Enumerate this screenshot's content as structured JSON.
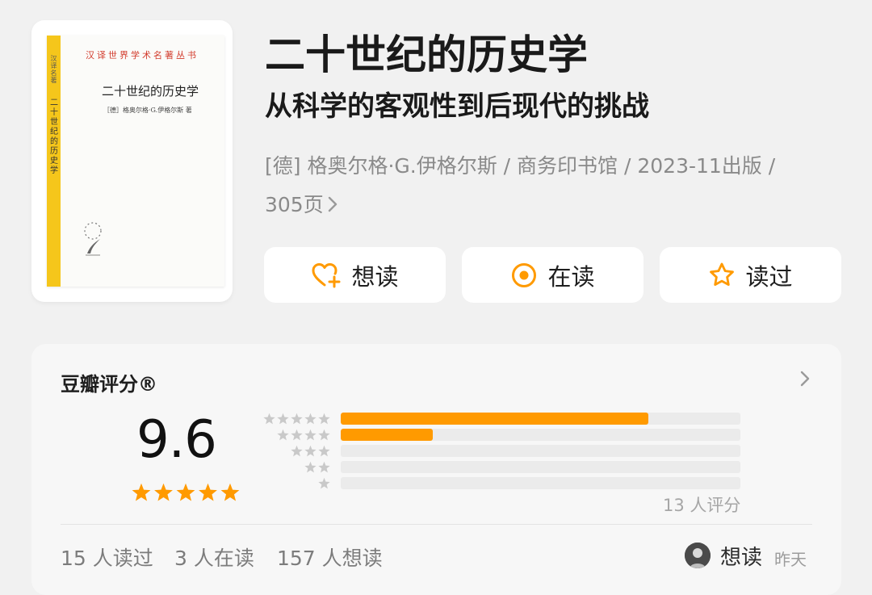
{
  "book": {
    "title": "二十世纪的历史学",
    "subtitle": "从科学的客观性到后现代的挑战",
    "meta_line": "[德] 格奥尔格·G.伊格尔斯 / 商务印书馆 / 2023-11出版 /",
    "pages": "305页",
    "cover": {
      "series": "汉译世界学术名著丛书",
      "title": "二十世纪的历史学",
      "author": "［德］格奥尔格·G.伊格尔斯 著",
      "spine_series": "汉译名著",
      "spine_title": "二十世纪的历史学",
      "publisher": "商务印书馆"
    }
  },
  "actions": {
    "want_label": "想读",
    "reading_label": "在读",
    "read_label": "读过",
    "accent": "#ff9a00"
  },
  "rating": {
    "header": "豆瓣评分®",
    "score": "9.6",
    "score_stars": 5,
    "distribution": [
      {
        "stars": 5,
        "fraction": 0.77
      },
      {
        "stars": 4,
        "fraction": 0.23
      },
      {
        "stars": 3,
        "fraction": 0
      },
      {
        "stars": 2,
        "fraction": 0
      },
      {
        "stars": 1,
        "fraction": 0
      }
    ],
    "count_label": "13 人评分",
    "bar_color": "#ff9a00",
    "track_color": "#ebebeb"
  },
  "stats": {
    "read": "15 人读过",
    "reading": "3 人在读",
    "want": "157 人想读"
  },
  "activity": {
    "avatar_icon": "user-avatar",
    "action": "想读",
    "time": "昨天"
  }
}
